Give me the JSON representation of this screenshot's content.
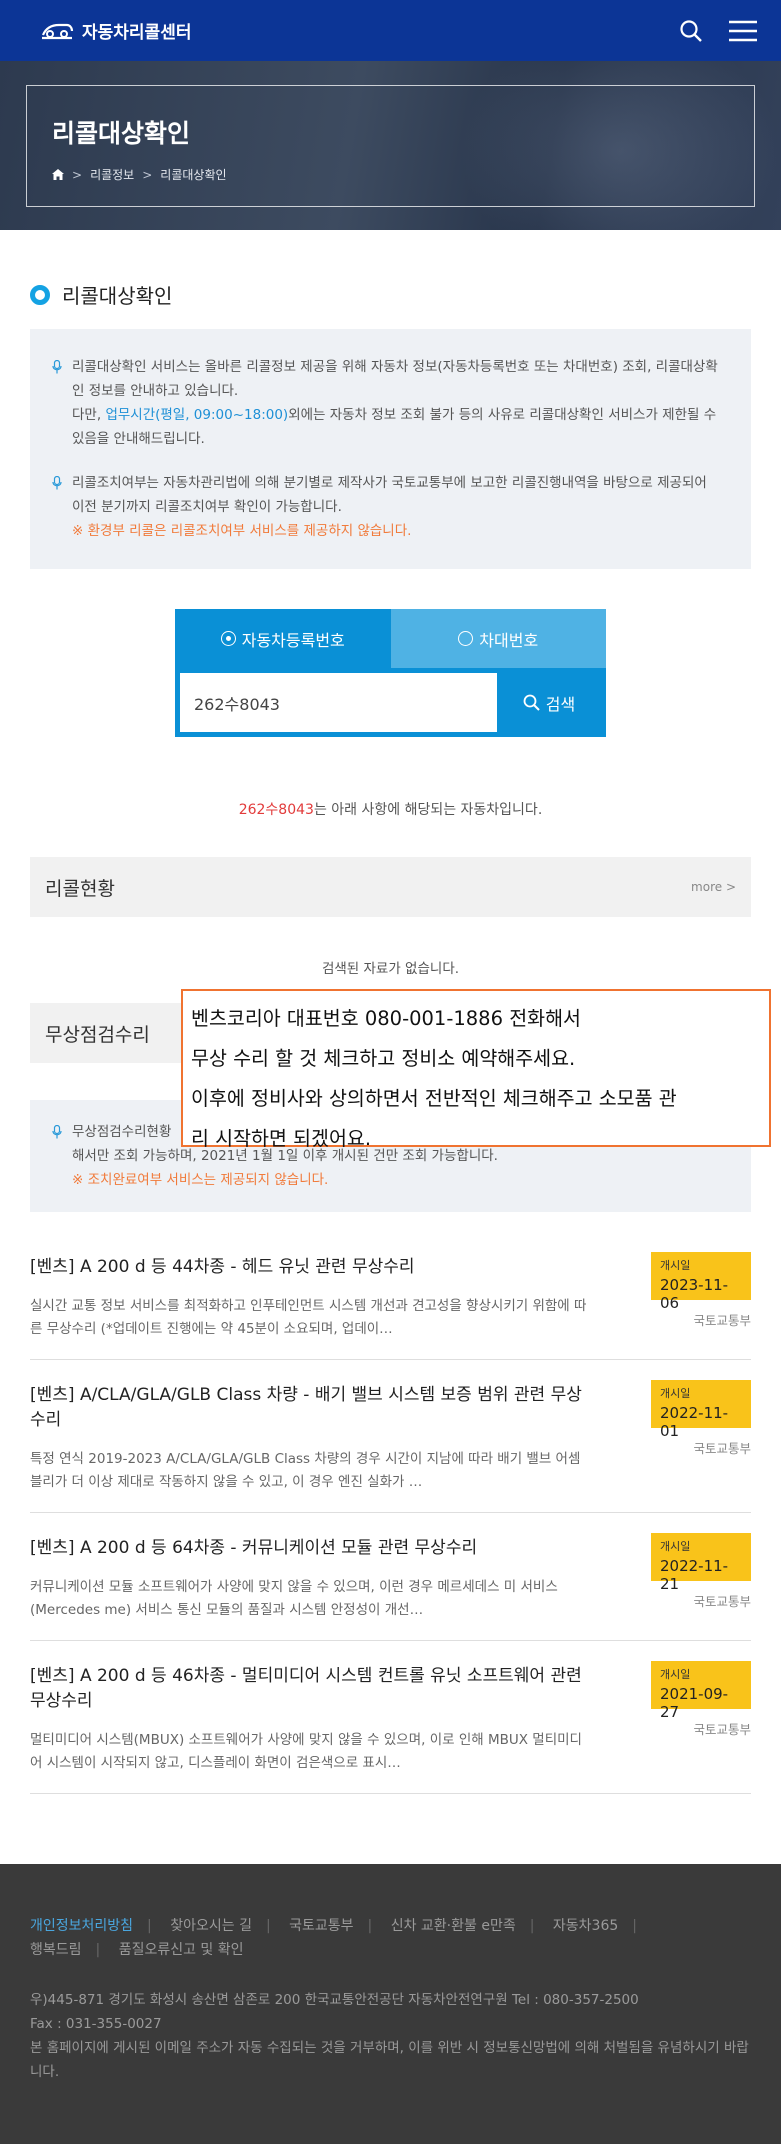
{
  "header": {
    "logo_text": "자동차리콜센터",
    "icons": [
      "car-logo-icon",
      "search-icon",
      "menu-icon"
    ]
  },
  "hero": {
    "title": "리콜대상확인",
    "breadcrumb": [
      "리콜정보",
      "리콜대상확인"
    ]
  },
  "section": {
    "title": "리콜대상확인"
  },
  "notice": {
    "p1_a": "리콜대상확인 서비스는 올바른 리콜정보 제공을 위해 자동차 정보(자동차등록번호 또는 차대번호) 조회, 리콜대상확인 정보를 안내하고 있습니다.",
    "p1_b_prefix": "다만, ",
    "p1_b_link": "업무시간(평일, 09:00~18:00)",
    "p1_b_suffix": "외에는 자동차 정보 조회 불가 등의 사유로 리콜대상확인 서비스가 제한될 수 있음을 안내해드립니다.",
    "p2": "리콜조치여부는 자동차관리법에 의해 분기별로 제작사가 국토교통부에 보고한 리콜진행내역을 바탕으로 제공되어 이전 분기까지 리콜조치여부 확인이 가능합니다.",
    "p2_warn": "※ 환경부 리콜은 리콜조치여부 서비스를 제공하지 않습니다."
  },
  "search": {
    "tab_active": "자동차등록번호",
    "tab_inactive": "차대번호",
    "input_value": "262수8043",
    "button": "검색"
  },
  "result": {
    "plate": "262수8043",
    "suffix": "는 아래 사항에 해당되는 자동차입니다."
  },
  "recall_status": {
    "title": "리콜현황",
    "more": "more >",
    "empty": "검색된 자료가 없습니다."
  },
  "free_repair": {
    "title": "무상점검수리",
    "notice_line1": "무상점검수리현황",
    "notice_line2": "해서만 조회 가능하며, 2021년 1월 1일 이후 개시된 건만 조회 가능합니다.",
    "notice_warn": "※ 조치완료여부 서비스는 제공되지 않습니다."
  },
  "memo": {
    "lines": [
      "벤츠코리아 대표번호 080-001-1886 전화해서",
      "무상 수리 할 것 체크하고   정비소 예약해주세요.",
      "이후에 정비사와 상의하면서  전반적인 체크해주고 소모품 관",
      "리 시작하면 되겠어요."
    ]
  },
  "items": [
    {
      "title": "[벤츠] A 200 d 등 44차종 - 헤드 유닛 관련 무상수리",
      "desc": "실시간 교통 정보 서비스를 최적화하고 인푸테인먼트 시스템 개선과 견고성을 향상시키기 위함에 따른 무상수리 (*업데이트 진행에는 약 45분이 소요되며, 업데이…",
      "badge_label": "개시일",
      "date": "2023-11-06",
      "org": "국토교통부"
    },
    {
      "title": "[벤츠] A/CLA/GLA/GLB Class 차량 - 배기 밸브 시스템 보증 범위 관련 무상수리",
      "desc": "특정 연식 2019-2023 A/CLA/GLA/GLB Class 차량의 경우 시간이 지남에 따라 배기 밸브 어셈블리가 더 이상 제대로 작동하지 않을 수 있고, 이 경우 엔진 실화가 …",
      "badge_label": "개시일",
      "date": "2022-11-01",
      "org": "국토교통부"
    },
    {
      "title": "[벤츠] A 200 d 등 64차종 - 커뮤니케이션 모듈 관련 무상수리",
      "desc": "커뮤니케이션 모듈 소프트웨어가 사양에 맞지 않을 수 있으며, 이런 경우 메르세데스 미 서비스(Mercedes me) 서비스 통신 모듈의 품질과 시스템 안정성이 개선…",
      "badge_label": "개시일",
      "date": "2022-11-21",
      "org": "국토교통부"
    },
    {
      "title": "[벤츠] A 200 d 등 46차종 - 멀티미디어 시스템 컨트롤 유닛 소프트웨어 관련 무상수리",
      "desc": "멀티미디어 시스템(MBUX) 소프트웨어가 사양에 맞지 않을 수 있으며, 이로 인해 MBUX 멀티미디어 시스템이 시작되지 않고, 디스플레이 화면이 검은색으로 표시…",
      "badge_label": "개시일",
      "date": "2021-09-27",
      "org": "국토교통부"
    }
  ],
  "footer": {
    "links": [
      "개인정보처리방침",
      "찾아오시는 길",
      "국토교통부",
      "신차 교환·환불 e만족",
      "자동차365",
      "행복드림",
      "품질오류신고 및 확인"
    ],
    "address": "우)445-871 경기도 화성시 송산면 삼존로 200 한국교통안전공단 자동차안전연구원 Tel : 080-357-2500",
    "fax": "Fax : 031-355-0027",
    "policy": "본 홈페이지에 게시된 이메일 주소가 자동 수집되는 것을 거부하며, 이를 위반 시 정보통신망법에 의해 처벌됨을 유념하시기 바랍니다."
  }
}
